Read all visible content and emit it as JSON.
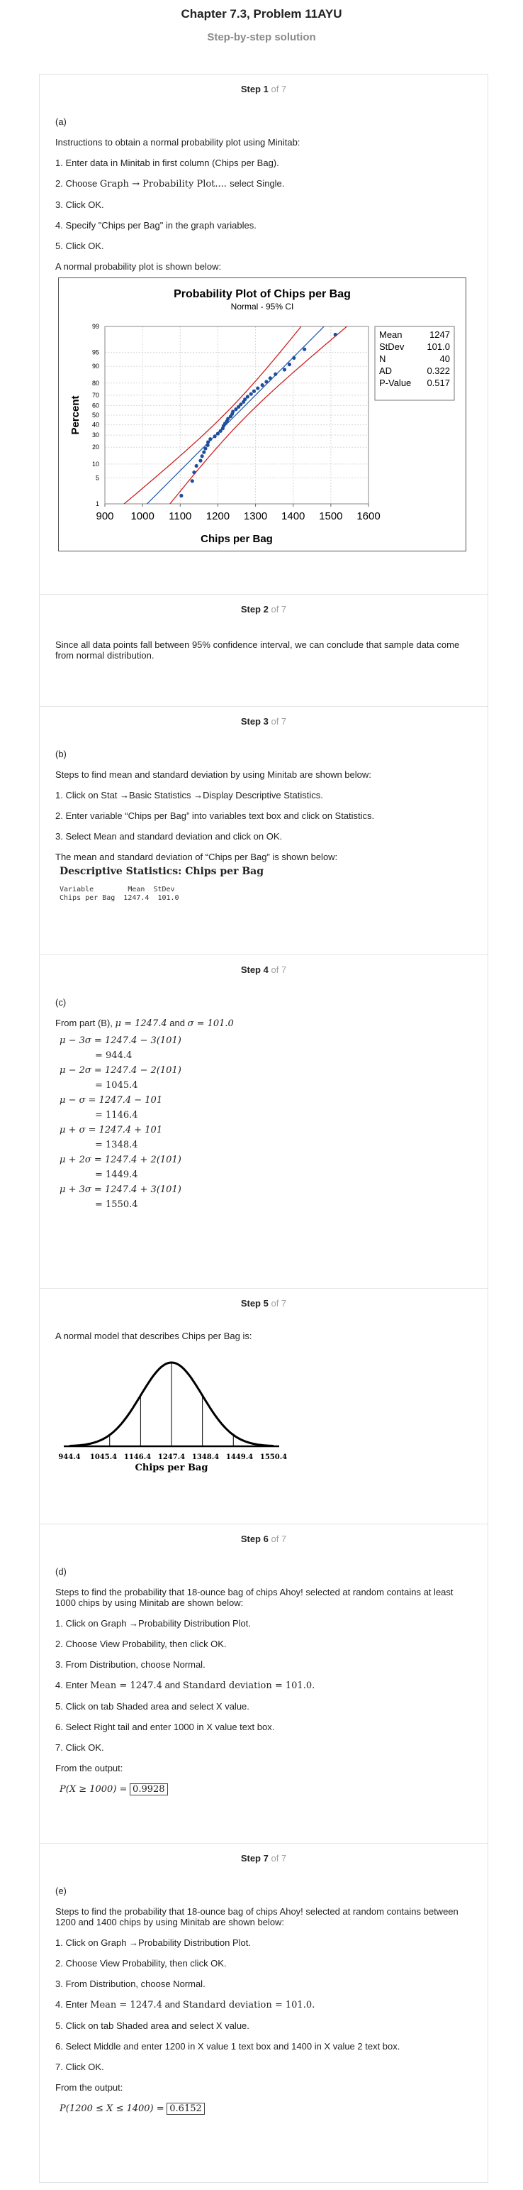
{
  "header": {
    "title": "Chapter 7.3, Problem 11AYU",
    "subtitle": "Step-by-step solution"
  },
  "steps": [
    {
      "label": "Step 1",
      "of": "of 7",
      "part": "(a)",
      "intro": "Instructions to obtain a normal probability plot using Minitab:",
      "items": [
        "1. Enter data in Minitab in first column (Chips per Bag).",
        "2. Choose",
        "3. Click OK.",
        "4. Specify \"Chips per Bag\" in the graph variables.",
        "5. Click OK."
      ],
      "item2_math": "Graph → Probability Plot.... ",
      "item2_tail": "select Single.",
      "outro": "A normal probability plot is shown below:"
    },
    {
      "label": "Step 2",
      "of": "of 7",
      "text": "Since all data points fall between 95% confidence interval, we can conclude that sample data come from normal distribution."
    },
    {
      "label": "Step 3",
      "of": "of 7",
      "part": "(b)",
      "intro": "Steps to find mean and standard deviation by using Minitab are shown below:",
      "items": [
        "1. Click on Stat →Basic Statistics →Display Descriptive Statistics.",
        "2. Enter variable “Chips per Bag” into variables text box and click on Statistics.",
        "3. Select Mean and standard deviation and click on OK."
      ],
      "outro": "The mean and standard deviation of “Chips per Bag” is shown below:",
      "desc_title": "Descriptive Statistics: Chips per Bag",
      "table_header": "Variable        Mean  StDev",
      "table_row": "Chips per Bag  1247.4  101.0"
    },
    {
      "label": "Step 4",
      "of": "of 7",
      "part": "(c)",
      "from_text": "From part (B),",
      "mu_eq": "μ = 1247.4",
      "and": "and",
      "sigma_eq": "σ = 101.0",
      "equations": [
        {
          "lhs": "μ − 3σ = 1247.4 − 3(101)",
          "res": "= 944.4"
        },
        {
          "lhs": "μ − 2σ = 1247.4 − 2(101)",
          "res": "= 1045.4"
        },
        {
          "lhs": "μ − σ = 1247.4 − 101",
          "res": "= 1146.4"
        },
        {
          "lhs": "μ + σ = 1247.4 + 101",
          "res": "= 1348.4"
        },
        {
          "lhs": "μ + 2σ = 1247.4 + 2(101)",
          "res": "= 1449.4"
        },
        {
          "lhs": "μ + 3σ = 1247.4 + 3(101)",
          "res": "= 1550.4"
        }
      ]
    },
    {
      "label": "Step 5",
      "of": "of 7",
      "text": "A normal model that describes Chips per Bag is:",
      "curve_ticks": [
        "944.4",
        "1045.4",
        "1146.4",
        "1247.4",
        "1348.4",
        "1449.4",
        "1550.4"
      ],
      "curve_xlabel": "Chips per Bag"
    },
    {
      "label": "Step 6",
      "of": "of 7",
      "part": "(d)",
      "intro": "Steps to find the probability that 18-ounce bag of chips Ahoy! selected at random contains at least 1000 chips by using Minitab are shown below:",
      "items": [
        "1. Click on Graph →Probability Distribution Plot.",
        "2. Choose View Probability, then click OK.",
        "3. From Distribution, choose Normal.",
        "4. Enter",
        "5. Click on tab Shaded area and select X value.",
        "6. Select Right tail and enter 1000 in X value text box.",
        "7. Click OK."
      ],
      "enter_mean": "Mean = 1247.4",
      "enter_and": "and",
      "enter_sd": "Standard deviation = 101.0.",
      "outro": "From the output:",
      "result_lhs": "P(X ≥ 1000) =",
      "result_val": "0.9928"
    },
    {
      "label": "Step 7",
      "of": "of 7",
      "part": "(e)",
      "intro": "Steps to find the probability that 18-ounce bag of chips Ahoy! selected at random contains between 1200 and 1400 chips by using Minitab are shown below:",
      "items": [
        "1. Click on Graph →Probability Distribution Plot.",
        "2. Choose View Probability, then click OK.",
        "3. From Distribution, choose Normal.",
        "4. Enter",
        "5. Click on tab Shaded area and select X value.",
        "6. Select Middle and enter 1200 in X value 1 text box and 1400 in X value 2 text box.",
        "7. Click OK."
      ],
      "enter_mean": "Mean = 1247.4",
      "enter_and": "and",
      "enter_sd": "Standard deviation = 101.0.",
      "outro": "From the output:",
      "result_lhs": "P(1200 ≤ X ≤ 1400) =",
      "result_val": "0.6152"
    }
  ],
  "chart_data": {
    "type": "scatter",
    "title": "Probability Plot of Chips per Bag",
    "subtitle": "Normal - 95% CI",
    "xlabel": "Chips per Bag",
    "ylabel": "Percent",
    "xticks": [
      "900",
      "1000",
      "1100",
      "1200",
      "1300",
      "1400",
      "1500",
      "1600"
    ],
    "yticks": [
      "1",
      "5",
      "10",
      "20",
      "30",
      "40",
      "50",
      "60",
      "70",
      "80",
      "90",
      "95",
      "99"
    ],
    "xlim": [
      900,
      1600
    ],
    "ylim_percent": [
      1,
      99
    ],
    "yscale": "normal-probability",
    "grid": true,
    "legend_position": "right",
    "stats_labels": [
      "Mean",
      "StDev",
      "N",
      "AD",
      "P-Value"
    ],
    "stats_values": [
      "1247",
      "101.0",
      "40",
      "0.322",
      "0.517"
    ],
    "point_color": "#1f4e9c",
    "fit_line_color": "#2a5db0",
    "ci_line_color": "#cc2222",
    "x": [
      1103,
      1132,
      1137,
      1143,
      1154,
      1158,
      1163,
      1167,
      1173,
      1174,
      1180,
      1192,
      1200,
      1207,
      1213,
      1215,
      1219,
      1224,
      1227,
      1234,
      1238,
      1240,
      1248,
      1255,
      1261,
      1268,
      1272,
      1279,
      1288,
      1296,
      1306,
      1318,
      1329,
      1339,
      1353,
      1377,
      1390,
      1402,
      1430,
      1512
    ]
  }
}
